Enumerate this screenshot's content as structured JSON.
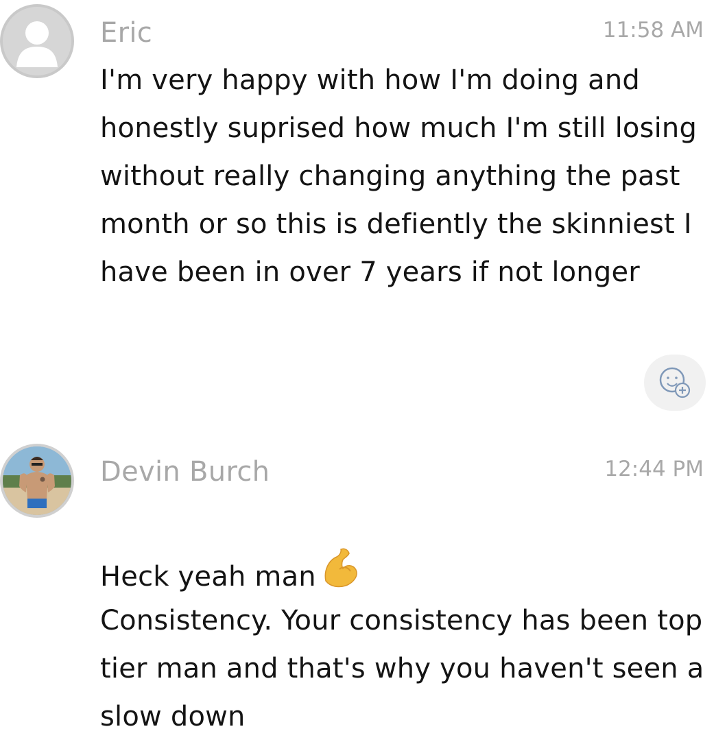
{
  "messages": [
    {
      "sender": "Eric",
      "time": "11:58 AM",
      "text": "I'm very happy with how I'm doing and honestly suprised how much I'm still losing without really changing anything the past month or so this is defiently the skinniest I have been in over 7 years if not longer",
      "avatar": "default-person-avatar"
    },
    {
      "sender": "Devin Burch",
      "time": "12:44 PM",
      "line1": "Heck yeah man",
      "emoji": "flexed-biceps-icon",
      "text2": "Consistency. Your consistency has been top tier man and that's why you haven't seen a slow down",
      "avatar": "profile-photo-avatar"
    }
  ],
  "reaction_button": {
    "icon": "add-reaction-icon"
  },
  "colors": {
    "meta": "#a8a8a8",
    "text": "#141414",
    "reaction_bg": "#f1f1f1",
    "emoji": "#f2b93b"
  }
}
